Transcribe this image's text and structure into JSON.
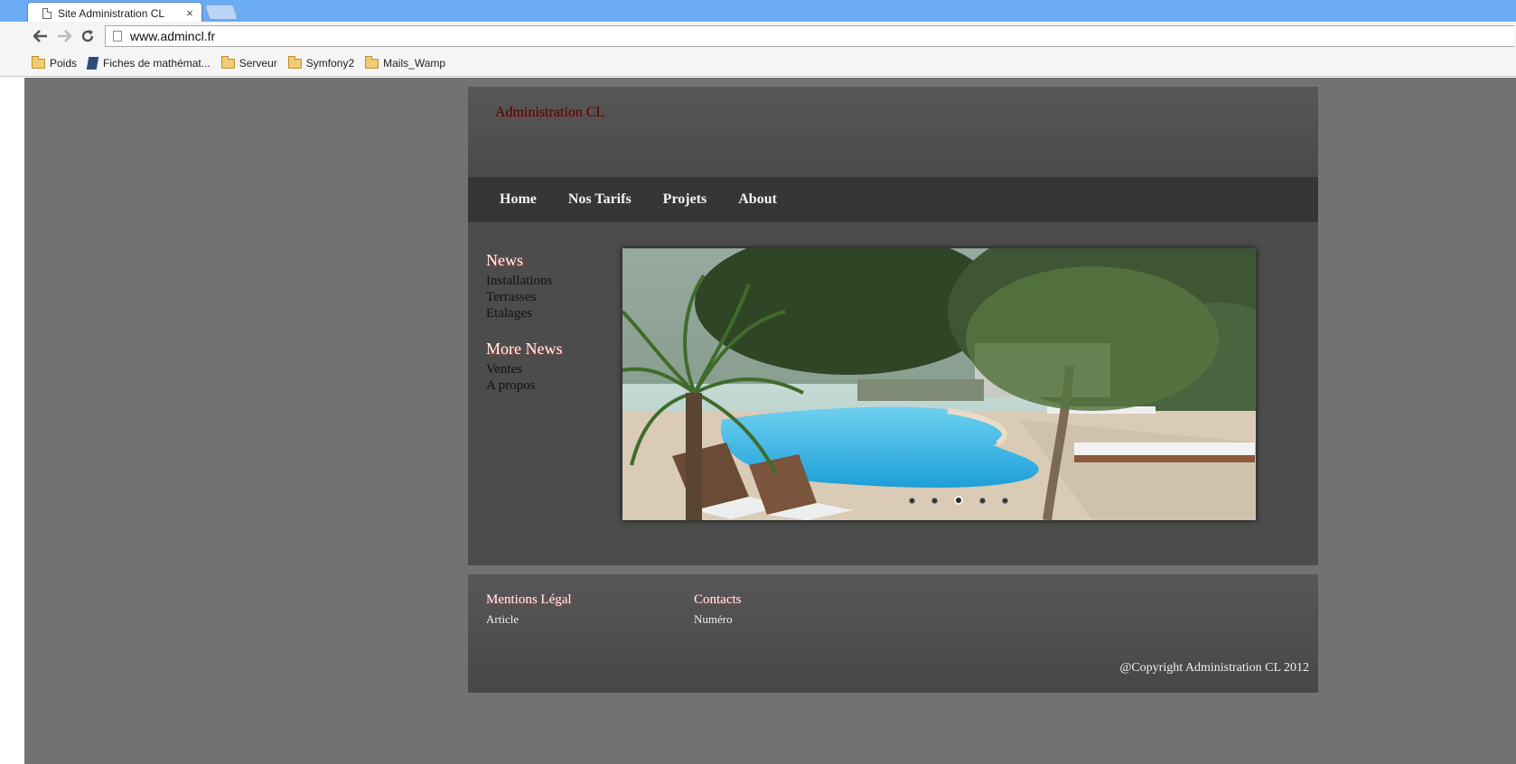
{
  "browser": {
    "tab_title": "Site Administration CL",
    "tab_close": "×",
    "url": "www.admincl.fr",
    "back_icon": "arrow-left-icon",
    "forward_icon": "arrow-right-icon",
    "reload_icon": "reload-icon"
  },
  "bookmarks": [
    {
      "label": "Poids",
      "icon": "folder-icon"
    },
    {
      "label": "Fiches de mathémat...",
      "icon": "book-icon"
    },
    {
      "label": "Serveur",
      "icon": "folder-icon"
    },
    {
      "label": "Symfony2",
      "icon": "folder-icon"
    },
    {
      "label": "Mails_Wamp",
      "icon": "folder-icon"
    }
  ],
  "site": {
    "title": "Administration CL",
    "nav": [
      "Home",
      "Nos Tarifs",
      "Projets",
      "About"
    ],
    "sidebar": {
      "news_heading": "News",
      "news_links": [
        "Installations",
        "Terrasses",
        "Etalages"
      ],
      "more_heading": "More News",
      "more_links": [
        "Ventes",
        "A propos"
      ]
    },
    "slider": {
      "slide_count": 5,
      "active_slide": 3
    },
    "footer": {
      "col1_heading": "Mentions Légal",
      "col1_link": "Article",
      "col2_heading": "Contacts",
      "col2_link": "Numéro",
      "copyright": "@Copyright Administration CL 2012"
    }
  }
}
